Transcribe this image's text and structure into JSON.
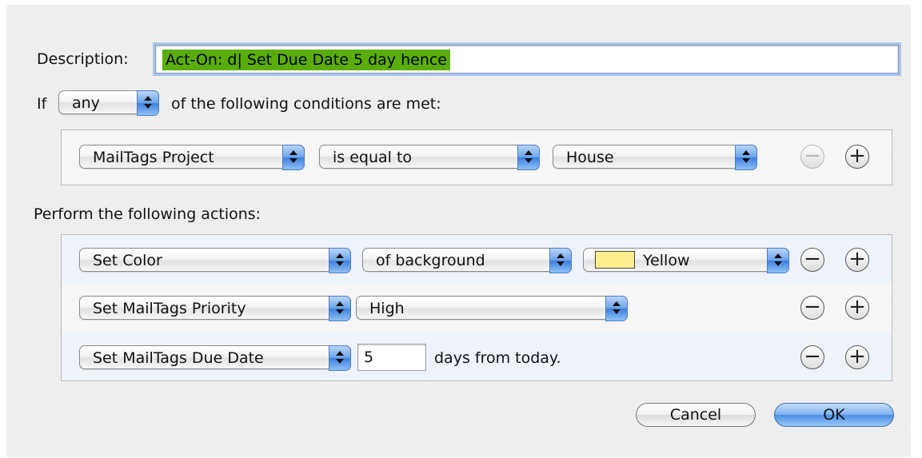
{
  "description": {
    "label": "Description:",
    "value": "Act-On: d| Set Due Date 5 day hence"
  },
  "conditions": {
    "if_label": "If",
    "match_value": "any",
    "suffix_label": "of the following conditions are met:",
    "row": {
      "field": "MailTags Project",
      "operator": "is equal to",
      "value": "House",
      "remove_symbol": "−",
      "add_symbol": "+"
    }
  },
  "actions": {
    "label": "Perform the following actions:",
    "rows": [
      {
        "action": "Set Color",
        "param": "of background",
        "value": "Yellow",
        "swatch_color": "#fbf08d"
      },
      {
        "action": "Set MailTags Priority",
        "param": "High"
      },
      {
        "action": "Set MailTags Due Date",
        "input_value": "5",
        "suffix": "days from today."
      }
    ],
    "remove_symbol": "−",
    "add_symbol": "+"
  },
  "buttons": {
    "cancel": "Cancel",
    "ok": "OK"
  },
  "colors": {
    "selection_highlight": "#5aae0b",
    "focus_ring": "#a9c6ea",
    "popup_arrow_blue": "#3f80de",
    "alt_row": "#eef3fb"
  }
}
